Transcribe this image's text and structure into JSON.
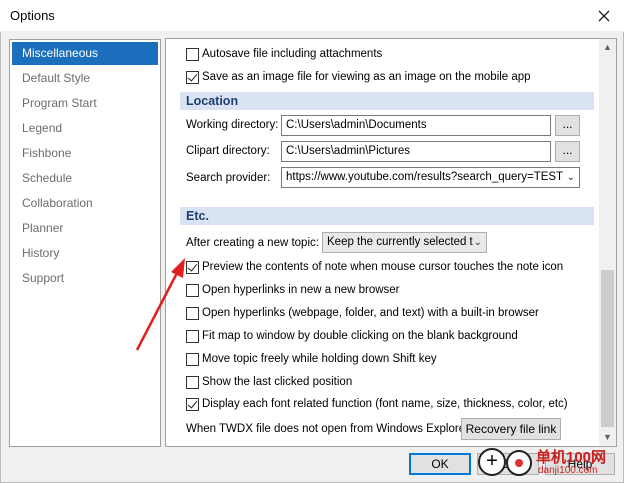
{
  "window": {
    "title": "Options",
    "close_icon": "close-icon"
  },
  "sidebar": {
    "items": [
      {
        "label": "Miscellaneous",
        "active": true
      },
      {
        "label": "Default Style",
        "active": false
      },
      {
        "label": "Program Start",
        "active": false
      },
      {
        "label": "Legend",
        "active": false
      },
      {
        "label": "Fishbone",
        "active": false
      },
      {
        "label": "Schedule",
        "active": false
      },
      {
        "label": "Collaboration",
        "active": false
      },
      {
        "label": "Planner",
        "active": false
      },
      {
        "label": "History",
        "active": false
      },
      {
        "label": "Support",
        "active": false
      }
    ]
  },
  "top_options": [
    {
      "label": "Autosave file including attachments",
      "checked": false
    },
    {
      "label": "Save as an image file for viewing as an image on the mobile app",
      "checked": true
    }
  ],
  "location": {
    "header": "Location",
    "working_dir_label": "Working directory:",
    "working_dir_value": "C:\\Users\\admin\\Documents",
    "clipart_dir_label": "Clipart directory:",
    "clipart_dir_value": "C:\\Users\\admin\\Pictures",
    "search_provider_label": "Search provider:",
    "search_provider_value": "https://www.youtube.com/results?search_query=TEST",
    "browse_label": "..."
  },
  "etc": {
    "header": "Etc.",
    "after_topic_label": "After creating a new topic:",
    "after_topic_value": "Keep the currently selected t",
    "options": [
      {
        "label": "Preview the contents of note when mouse cursor touches the note icon",
        "checked": true
      },
      {
        "label": "Open hyperlinks in new a new browser",
        "checked": false
      },
      {
        "label": "Open hyperlinks (webpage, folder, and text) with a built-in browser",
        "checked": false
      },
      {
        "label": "Fit map to window by double clicking on the blank background",
        "checked": false
      },
      {
        "label": "Move topic freely while holding down Shift key",
        "checked": false
      },
      {
        "label": "Show the last clicked position",
        "checked": false
      },
      {
        "label": "Display each font related function (font name, size, thickness, color, etc)",
        "checked": true
      }
    ],
    "twdx_label": "When TWDX file does not open from Windows Explorer:",
    "recovery_button": "Recovery file link"
  },
  "footer": {
    "ok_label": "OK",
    "cancel_label": "Ca",
    "help_label": "Help"
  },
  "watermark": {
    "text_cn": "单机100网",
    "text_url": "danji100.com"
  },
  "colors": {
    "accent": "#1b6fbd",
    "section_bg": "#dae3f3",
    "annotation_arrow": "#e02020"
  }
}
